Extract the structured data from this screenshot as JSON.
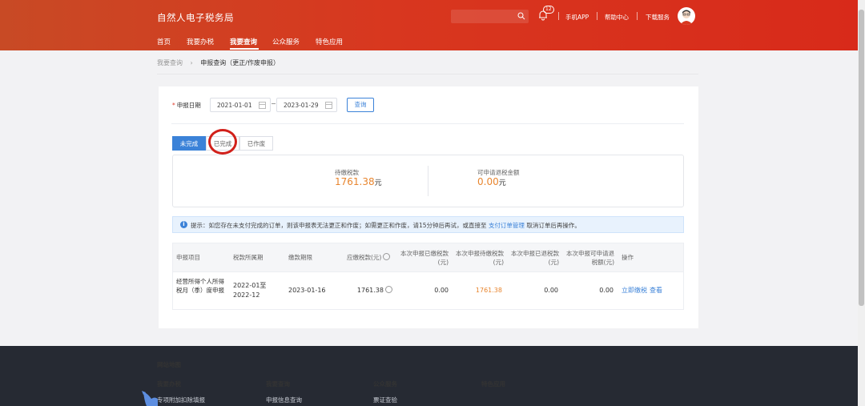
{
  "header": {
    "logo": "自然人电子税务局",
    "bell_count": "12",
    "links": [
      "手机APP",
      "帮助中心",
      "下载服务"
    ]
  },
  "nav": {
    "items": [
      "首页",
      "我要办税",
      "我要查询",
      "公众服务",
      "特色应用"
    ],
    "active": "我要查询"
  },
  "breadcrumb": {
    "root": "我要查询",
    "current": "申报查询（更正/作废申报）"
  },
  "filter": {
    "label": "申报日期",
    "start_date": "2021-01-01",
    "end_date": "2023-01-29",
    "query_button": "查询"
  },
  "tabs": [
    "未完成",
    "已完成",
    "已作废"
  ],
  "summary": {
    "pending_label": "待缴税款",
    "pending_value": "1761.38",
    "refund_label": "可申请退税金额",
    "refund_value": "0.00",
    "unit": "元"
  },
  "notice": {
    "text": "提示：如您存在未支付完成的订单，则该申报表无法更正和作废；如需更正和作废，请15分钟后再试，或直接至",
    "link": "支付订单管理",
    "tail": "取消订单后再操作。"
  },
  "table": {
    "headers": [
      "申报项目",
      "税款所属期",
      "缴款期限",
      "应缴税款(元)",
      "本次申报已缴税款(元)",
      "本次申报待缴税款(元)",
      "本次申报已退税款(元)",
      "本次申报可申请退税额(元)",
      "操作"
    ],
    "rows": [
      {
        "item": "经营所得个人所得税月（季）度申报",
        "period": "2022-01至2022-12",
        "deadline": "2023-01-16",
        "tax_due": "1761.38",
        "paid": "0.00",
        "to_pay": "1761.38",
        "refunded": "0.00",
        "refundable": "0.00",
        "actions": [
          "立即缴税",
          "查看"
        ]
      }
    ]
  },
  "footer": {
    "title": "网站地图",
    "columns": [
      {
        "head": "我要办税",
        "first": "专项附加扣除填报"
      },
      {
        "head": "我要查询",
        "first": "申报信息查询"
      },
      {
        "head": "公众服务",
        "first": "票证查验"
      },
      {
        "head": "特色应用",
        "first": ""
      }
    ]
  },
  "colors": {
    "header_red": "#d8371f",
    "accent_blue": "#3b82d8",
    "amount_orange": "#e8852e",
    "highlight_circle": "#d1201a"
  }
}
